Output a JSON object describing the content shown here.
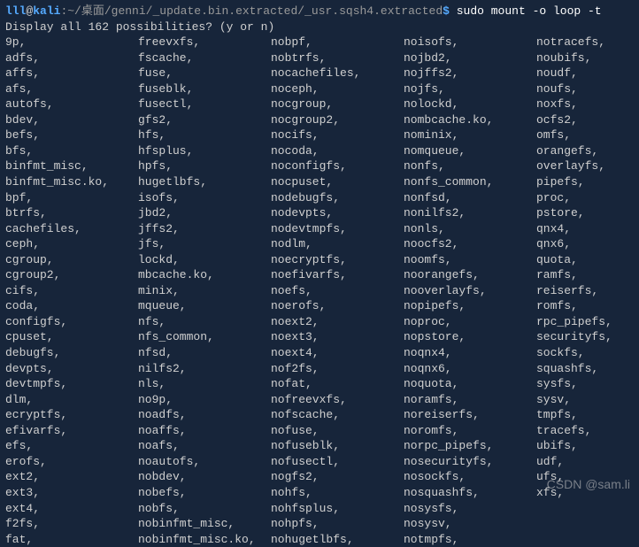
{
  "prompt": {
    "user": "lll",
    "at": "@",
    "host": "kali",
    "colon": ":",
    "path": "~/桌面/genni/_update.bin.extracted/_usr.sqsh4.extracted",
    "dollar": "$",
    "command": "sudo mount -o loop -t"
  },
  "question": "Display all 162 possibilities? (y or n)",
  "fs": {
    "c0": [
      "9p,",
      "adfs,",
      "affs,",
      "afs,",
      "autofs,",
      "bdev,",
      "befs,",
      "bfs,",
      "binfmt_misc,",
      "binfmt_misc.ko,",
      "bpf,",
      "btrfs,",
      "cachefiles,",
      "ceph,",
      "cgroup,",
      "cgroup2,",
      "cifs,",
      "coda,",
      "configfs,",
      "cpuset,",
      "debugfs,",
      "devpts,",
      "devtmpfs,",
      "dlm,",
      "ecryptfs,",
      "efivarfs,",
      "efs,",
      "erofs,",
      "ext2,",
      "ext3,",
      "ext4,",
      "f2fs,",
      "fat,"
    ],
    "c1": [
      "freevxfs,",
      "fscache,",
      "fuse,",
      "fuseblk,",
      "fusectl,",
      "gfs2,",
      "hfs,",
      "hfsplus,",
      "hpfs,",
      "hugetlbfs,",
      "isofs,",
      "jbd2,",
      "jffs2,",
      "jfs,",
      "lockd,",
      "mbcache.ko,",
      "minix,",
      "mqueue,",
      "nfs,",
      "nfs_common,",
      "nfsd,",
      "nilfs2,",
      "nls,",
      "no9p,",
      "noadfs,",
      "noaffs,",
      "noafs,",
      "noautofs,",
      "nobdev,",
      "nobefs,",
      "nobfs,",
      "nobinfmt_misc,",
      "nobinfmt_misc.ko,"
    ],
    "c2": [
      "nobpf,",
      "nobtrfs,",
      "nocachefiles,",
      "noceph,",
      "nocgroup,",
      "nocgroup2,",
      "nocifs,",
      "nocoda,",
      "noconfigfs,",
      "nocpuset,",
      "nodebugfs,",
      "nodevpts,",
      "nodevtmpfs,",
      "nodlm,",
      "noecryptfs,",
      "noefivarfs,",
      "noefs,",
      "noerofs,",
      "noext2,",
      "noext3,",
      "noext4,",
      "nof2fs,",
      "nofat,",
      "nofreevxfs,",
      "nofscache,",
      "nofuse,",
      "nofuseblk,",
      "nofusectl,",
      "nogfs2,",
      "nohfs,",
      "nohfsplus,",
      "nohpfs,",
      "nohugetlbfs,"
    ],
    "c3": [
      "noisofs,",
      "nojbd2,",
      "nojffs2,",
      "nojfs,",
      "nolockd,",
      "nombcache.ko,",
      "nominix,",
      "nomqueue,",
      "nonfs,",
      "nonfs_common,",
      "nonfsd,",
      "nonilfs2,",
      "nonls,",
      "noocfs2,",
      "noomfs,",
      "noorangefs,",
      "nooverlayfs,",
      "nopipefs,",
      "noproc,",
      "nopstore,",
      "noqnx4,",
      "noqnx6,",
      "noquota,",
      "noramfs,",
      "noreiserfs,",
      "noromfs,",
      "norpc_pipefs,",
      "nosecurityfs,",
      "nosockfs,",
      "nosquashfs,",
      "nosysfs,",
      "nosysv,",
      "notmpfs,"
    ],
    "c4": [
      "notracefs,",
      "noubifs,",
      "noudf,",
      "noufs,",
      "noxfs,",
      "ocfs2,",
      "omfs,",
      "orangefs,",
      "overlayfs,",
      "pipefs,",
      "proc,",
      "pstore,",
      "qnx4,",
      "qnx6,",
      "quota,",
      "ramfs,",
      "reiserfs,",
      "romfs,",
      "rpc_pipefs,",
      "securityfs,",
      "sockfs,",
      "squashfs,",
      "sysfs,",
      "sysv,",
      "tmpfs,",
      "tracefs,",
      "ubifs,",
      "udf,",
      "ufs,",
      "xfs,",
      "",
      "",
      ""
    ]
  },
  "watermark": "CSDN @sam.li"
}
